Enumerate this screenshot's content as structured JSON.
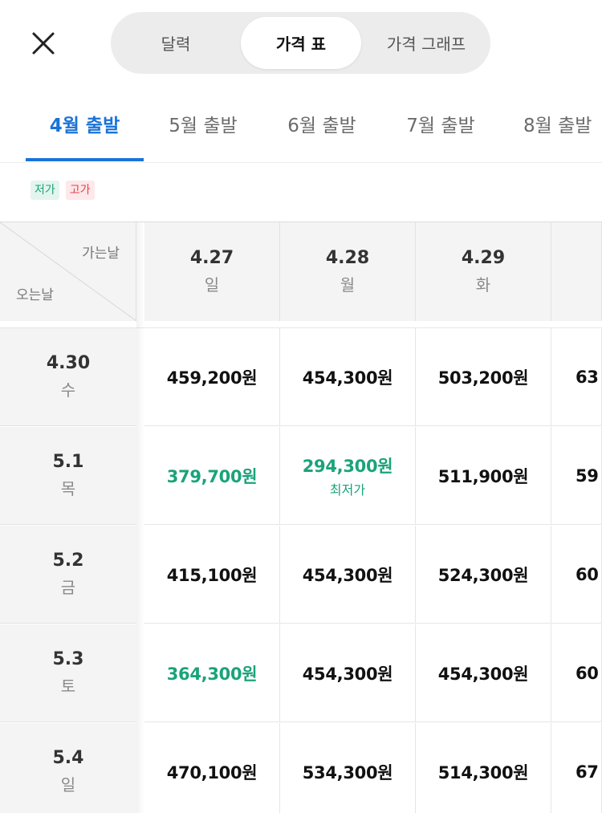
{
  "top_tabs": [
    {
      "label": "달력",
      "active": false
    },
    {
      "label": "가격 표",
      "active": true
    },
    {
      "label": "가격 그래프",
      "active": false
    }
  ],
  "month_tabs": [
    {
      "label": "4월 출발",
      "active": true
    },
    {
      "label": "5월 출발",
      "active": false
    },
    {
      "label": "6월 출발",
      "active": false
    },
    {
      "label": "7월 출발",
      "active": false
    },
    {
      "label": "8월 출발",
      "active": false
    }
  ],
  "legend": {
    "low": "저가",
    "high": "고가"
  },
  "corner": {
    "departure_label": "가는날",
    "return_label": "오는날"
  },
  "departures": [
    {
      "date": "4.27",
      "dow": "일"
    },
    {
      "date": "4.28",
      "dow": "월"
    },
    {
      "date": "4.29",
      "dow": "화"
    }
  ],
  "returns": [
    {
      "date": "4.30",
      "dow": "수",
      "prices": [
        "459,200원",
        "454,300원",
        "503,200원",
        "63"
      ],
      "low": [
        false,
        false,
        false,
        false
      ],
      "notes": [
        "",
        "",
        "",
        ""
      ]
    },
    {
      "date": "5.1",
      "dow": "목",
      "prices": [
        "379,700원",
        "294,300원",
        "511,900원",
        "59"
      ],
      "low": [
        true,
        true,
        false,
        false
      ],
      "notes": [
        "",
        "최저가",
        "",
        ""
      ]
    },
    {
      "date": "5.2",
      "dow": "금",
      "prices": [
        "415,100원",
        "454,300원",
        "524,300원",
        "60"
      ],
      "low": [
        false,
        false,
        false,
        false
      ],
      "notes": [
        "",
        "",
        "",
        ""
      ]
    },
    {
      "date": "5.3",
      "dow": "토",
      "prices": [
        "364,300원",
        "454,300원",
        "454,300원",
        "60"
      ],
      "low": [
        true,
        false,
        false,
        false
      ],
      "notes": [
        "",
        "",
        "",
        ""
      ]
    },
    {
      "date": "5.4",
      "dow": "일",
      "prices": [
        "470,100원",
        "534,300원",
        "514,300원",
        "67"
      ],
      "low": [
        false,
        false,
        false,
        false
      ],
      "notes": [
        "",
        "",
        "",
        ""
      ]
    }
  ],
  "colors": {
    "accent": "#1a73d9",
    "low_price": "#1aa37a",
    "high_price": "#e0454f"
  }
}
